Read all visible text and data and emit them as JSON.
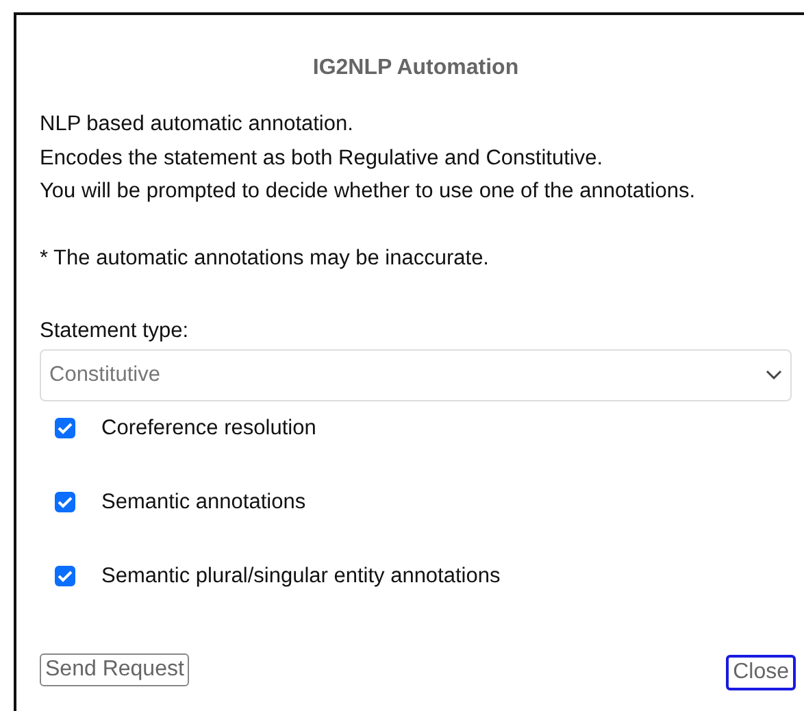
{
  "dialog": {
    "title": "IG2NLP Automation",
    "description": [
      "NLP based automatic annotation.",
      "Encodes the statement as both Regulative and Constitutive.",
      "You will be prompted to decide whether to use one of the annotations."
    ],
    "note": "* The automatic annotations may be inaccurate.",
    "statement_type": {
      "label": "Statement type:",
      "value": "Constitutive"
    },
    "options": [
      {
        "label": "Coreference resolution",
        "checked": true
      },
      {
        "label": "Semantic annotations",
        "checked": true
      },
      {
        "label": "Semantic plural/singular entity annotations",
        "checked": true
      }
    ],
    "buttons": [
      {
        "label": "Send Request",
        "focused": false
      },
      {
        "label": "Close",
        "focused": true
      }
    ]
  }
}
